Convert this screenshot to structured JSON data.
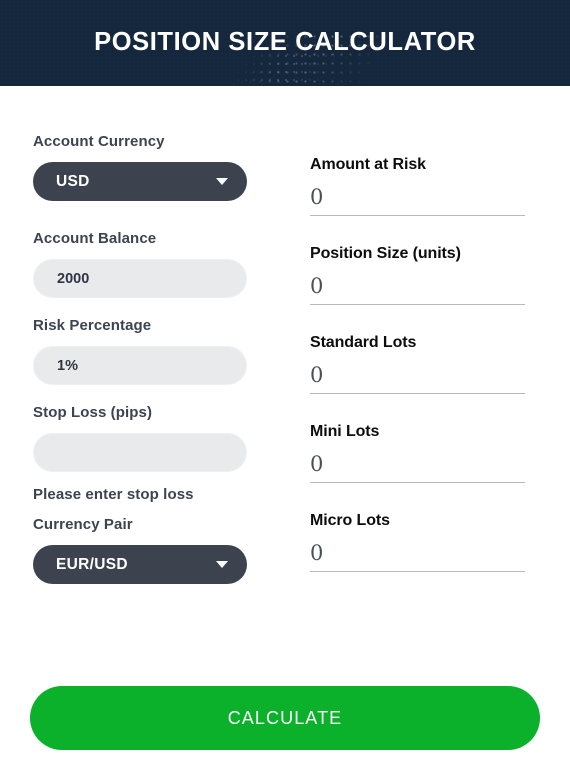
{
  "header": {
    "title": "POSITION SIZE CALCULATOR"
  },
  "form": {
    "account_currency": {
      "label": "Account Currency",
      "value": "USD",
      "caret_icon": "chevron-down-icon"
    },
    "account_balance": {
      "label": "Account Balance",
      "value": "2000",
      "placeholder": "Account Balance"
    },
    "risk_percentage": {
      "label": "Risk Percentage",
      "value": "1%",
      "placeholder": "Risk Percentage"
    },
    "stop_loss": {
      "label": "Stop Loss (pips)",
      "value": "",
      "placeholder": "",
      "hint": "Please enter stop loss"
    },
    "currency_pair": {
      "label": "Currency Pair",
      "value": "EUR/USD",
      "caret_icon": "chevron-down-icon"
    }
  },
  "results": [
    {
      "label": "Amount at Risk",
      "value": "0"
    },
    {
      "label": "Position Size (units)",
      "value": "0"
    },
    {
      "label": "Standard Lots",
      "value": "0"
    },
    {
      "label": "Mini Lots",
      "value": "0"
    },
    {
      "label": "Micro Lots",
      "value": "0"
    }
  ],
  "actions": {
    "calculate_label": "CALCULATE"
  },
  "colors": {
    "header_bg": "#15273c",
    "select_bg": "#3d434e",
    "input_bg": "#e9eaec",
    "label_text": "#3c4452",
    "result_label_text": "#0d0d0d",
    "result_value_text": "#4a5058",
    "rule": "#b7babd",
    "button_green": "#0bb02b",
    "button_text": "#ffffff"
  }
}
